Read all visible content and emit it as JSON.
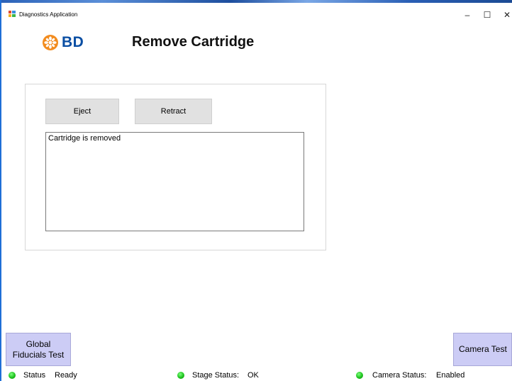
{
  "window": {
    "title": "Diagnostics Application",
    "minimize_glyph": "–",
    "maximize_glyph": "☐",
    "close_glyph": "✕"
  },
  "brand": {
    "logo_text": "BD",
    "logo_color": "#0a4ea3",
    "mark_color": "#f28c1f",
    "icon": "bd-sunburst-logo"
  },
  "page": {
    "title": "Remove Cartridge"
  },
  "actions": {
    "eject_label": "Eject",
    "retract_label": "Retract"
  },
  "output": {
    "text": "Cartridge is removed"
  },
  "side_buttons": {
    "global_fiducials_label": "Global\nFiducials Test",
    "camera_test_label": "Camera Test",
    "color": "#ccccf5"
  },
  "status": {
    "status_label": "Status",
    "status_value": "Ready",
    "stage_label": "Stage Status:",
    "stage_value": "OK",
    "camera_label": "Camera Status:",
    "camera_value": "Enabled",
    "indicator_color": "#1ec21e"
  }
}
